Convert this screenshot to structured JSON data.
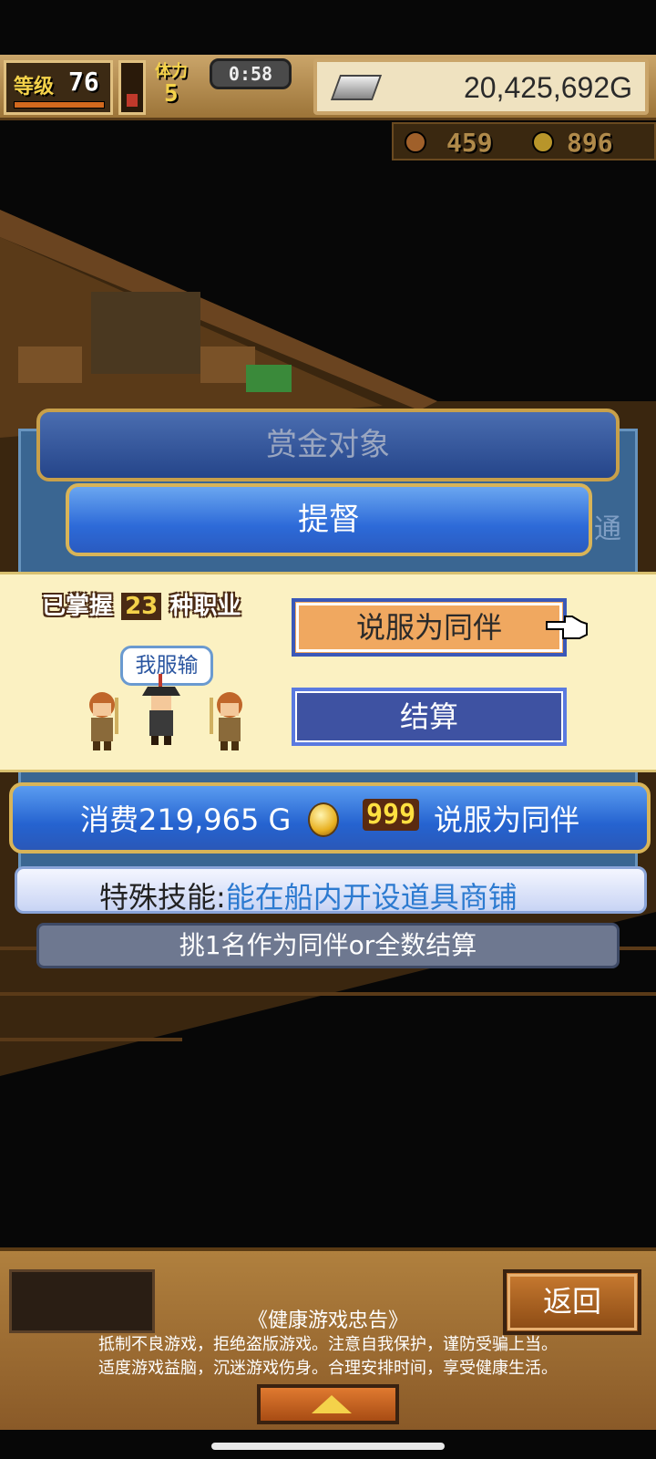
{
  "hud": {
    "level_label": "等级",
    "level_value": "76",
    "strength_label": "体力",
    "strength_value": "5",
    "timer": "0:58",
    "gold": "20,425,692G",
    "resource1": "459",
    "resource2": "896"
  },
  "dialog": {
    "bounty_title": "赏金对象",
    "class_name": "提督",
    "side_peek": "通",
    "mastered_prefix": "已掌握",
    "mastered_count": "23",
    "mastered_suffix": "种职业",
    "speech": "我服输",
    "persuade_label": "说服为同伴",
    "settle_label": "结算",
    "cost_text": "消费219,965 G",
    "premium_cost": "999",
    "cost_suffix": "说服为同伴",
    "skill_label": "特殊技能:",
    "skill_value": "能在船内开设道具商铺",
    "hint": "挑1名作为同伴or全数结算"
  },
  "bottom": {
    "back_label": "返回",
    "notice_title": "《健康游戏忠告》",
    "notice_line1": "抵制不良游戏，拒绝盗版游戏。注意自我保护，谨防受骗上当。",
    "notice_line2": "适度游戏益脑，沉迷游戏伤身。合理安排时间，享受健康生活。"
  },
  "colors": {
    "accent_blue": "#2d6ad8",
    "frame_gold": "#d8b458",
    "persuade_orange": "#f0a860",
    "skill_blue": "#2c7ad0"
  }
}
